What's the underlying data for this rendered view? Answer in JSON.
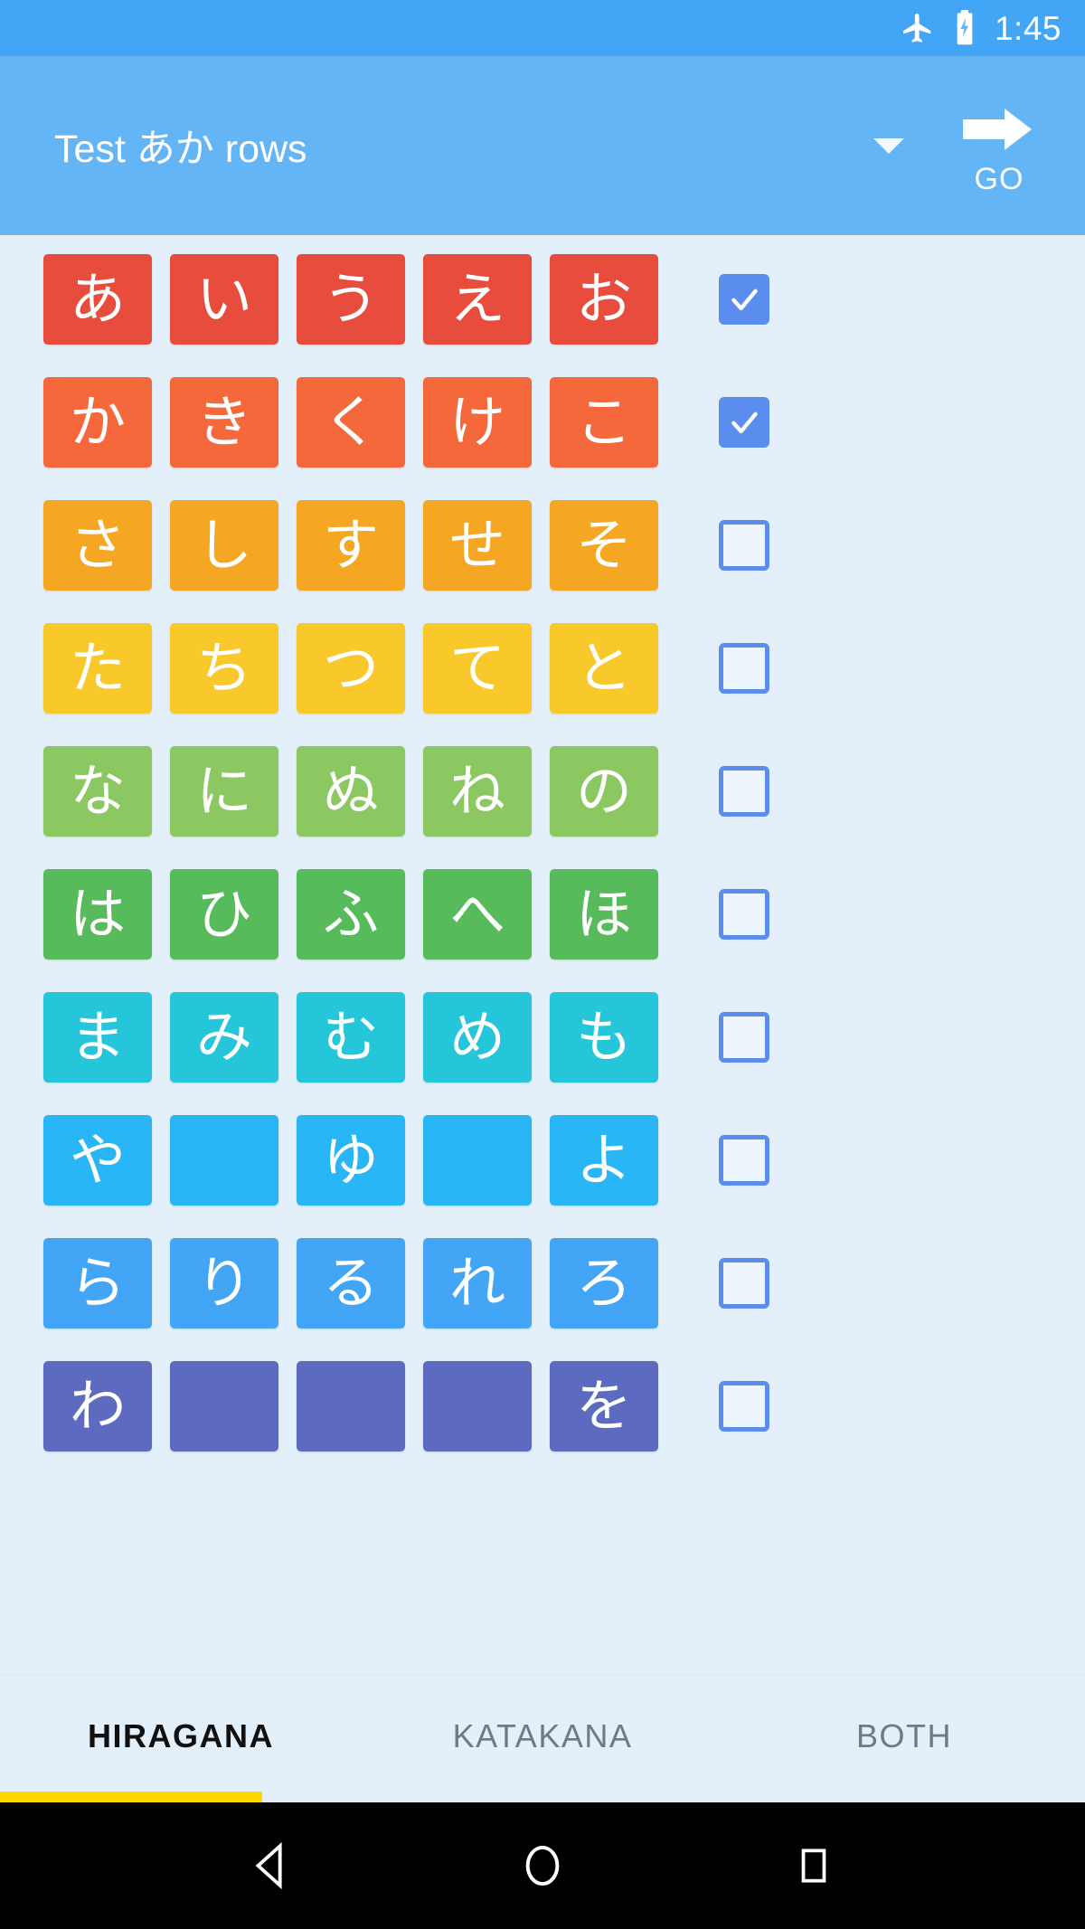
{
  "status_bar": {
    "airplane_icon": "airplane-mode-icon",
    "battery_icon": "battery-charging-icon",
    "time": "1:45"
  },
  "toolbar": {
    "spinner_value": "Test あか rows",
    "spinner_caret_icon": "chevron-down-icon",
    "go_arrow_icon": "arrow-right-icon",
    "go_label": "GO",
    "background_color": "#64B5F6"
  },
  "kana_grid": {
    "rows": [
      {
        "name": "a-row",
        "color": "#E74C3C",
        "checked": true,
        "kana": [
          "あ",
          "い",
          "う",
          "え",
          "お"
        ]
      },
      {
        "name": "ka-row",
        "color": "#F4683C",
        "checked": true,
        "kana": [
          "か",
          "き",
          "く",
          "け",
          "こ"
        ]
      },
      {
        "name": "sa-row",
        "color": "#F5A623",
        "checked": false,
        "kana": [
          "さ",
          "し",
          "す",
          "せ",
          "そ"
        ]
      },
      {
        "name": "ta-row",
        "color": "#F9C92C",
        "checked": false,
        "kana": [
          "た",
          "ち",
          "つ",
          "て",
          "と"
        ]
      },
      {
        "name": "na-row",
        "color": "#8CC861",
        "checked": false,
        "kana": [
          "な",
          "に",
          "ぬ",
          "ね",
          "の"
        ]
      },
      {
        "name": "ha-row",
        "color": "#57BB5B",
        "checked": false,
        "kana": [
          "は",
          "ひ",
          "ふ",
          "へ",
          "ほ"
        ]
      },
      {
        "name": "ma-row",
        "color": "#26C6DA",
        "checked": false,
        "kana": [
          "ま",
          "み",
          "む",
          "め",
          "も"
        ]
      },
      {
        "name": "ya-row",
        "color": "#29B6F6",
        "checked": false,
        "kana": [
          "や",
          "",
          "ゆ",
          "",
          "よ"
        ]
      },
      {
        "name": "ra-row",
        "color": "#42A5F5",
        "checked": false,
        "kana": [
          "ら",
          "り",
          "る",
          "れ",
          "ろ"
        ]
      },
      {
        "name": "wa-row",
        "color": "#5C6BC0",
        "checked": false,
        "kana": [
          "わ",
          "",
          "",
          "",
          "を"
        ]
      }
    ],
    "checkbox_color": "#5B8DEF",
    "background_color": "#E3F0FA"
  },
  "tabs": {
    "items": [
      {
        "label": "HIRAGANA",
        "active": true
      },
      {
        "label": "KATAKANA",
        "active": false
      },
      {
        "label": "BOTH",
        "active": false
      }
    ],
    "indicator_color": "#FFD600"
  },
  "nav_bar": {
    "back_icon": "back-triangle-icon",
    "home_icon": "home-circle-icon",
    "recents_icon": "recents-square-icon"
  }
}
